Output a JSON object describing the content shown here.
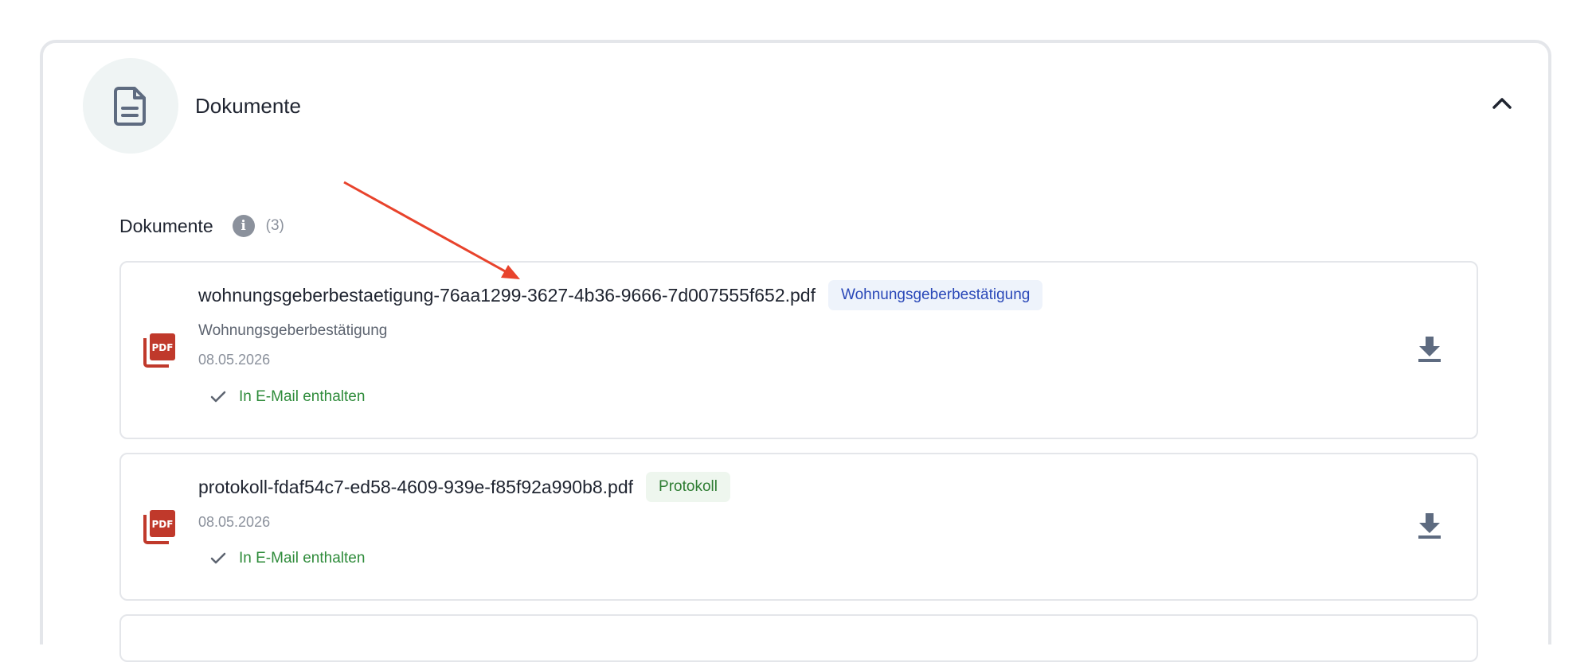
{
  "header": {
    "title": "Dokumente",
    "icon": "file-text-icon",
    "collapse_icon": "chevron-up-icon"
  },
  "section": {
    "label": "Dokumente",
    "info_icon": "info-icon",
    "info_glyph": "i",
    "count": "(3)"
  },
  "documents": [
    {
      "filename": "wohnungsgeberbestaetigung-76aa1299-3627-4b36-9666-7d007555f652.pdf",
      "badge": "Wohnungsgeberbestätigung",
      "subtitle": "Wohnungsgeberbestätigung",
      "date": "08.05.2026",
      "included_label": "In E-Mail enthalten",
      "icon": "pdf-file-icon"
    },
    {
      "filename": "protokoll-fdaf54c7-ed58-4609-939e-f85f92a990b8.pdf",
      "badge": "Protokoll",
      "date": "08.05.2026",
      "included_label": "In E-Mail enthalten",
      "icon": "pdf-file-icon"
    }
  ],
  "pdf_icon_text": "PDF",
  "colors": {
    "pdf_red": "#c0392b",
    "accent_blue": "#2a48b8",
    "success_green": "#2e8b3a",
    "annotation_red": "#e8432c"
  }
}
